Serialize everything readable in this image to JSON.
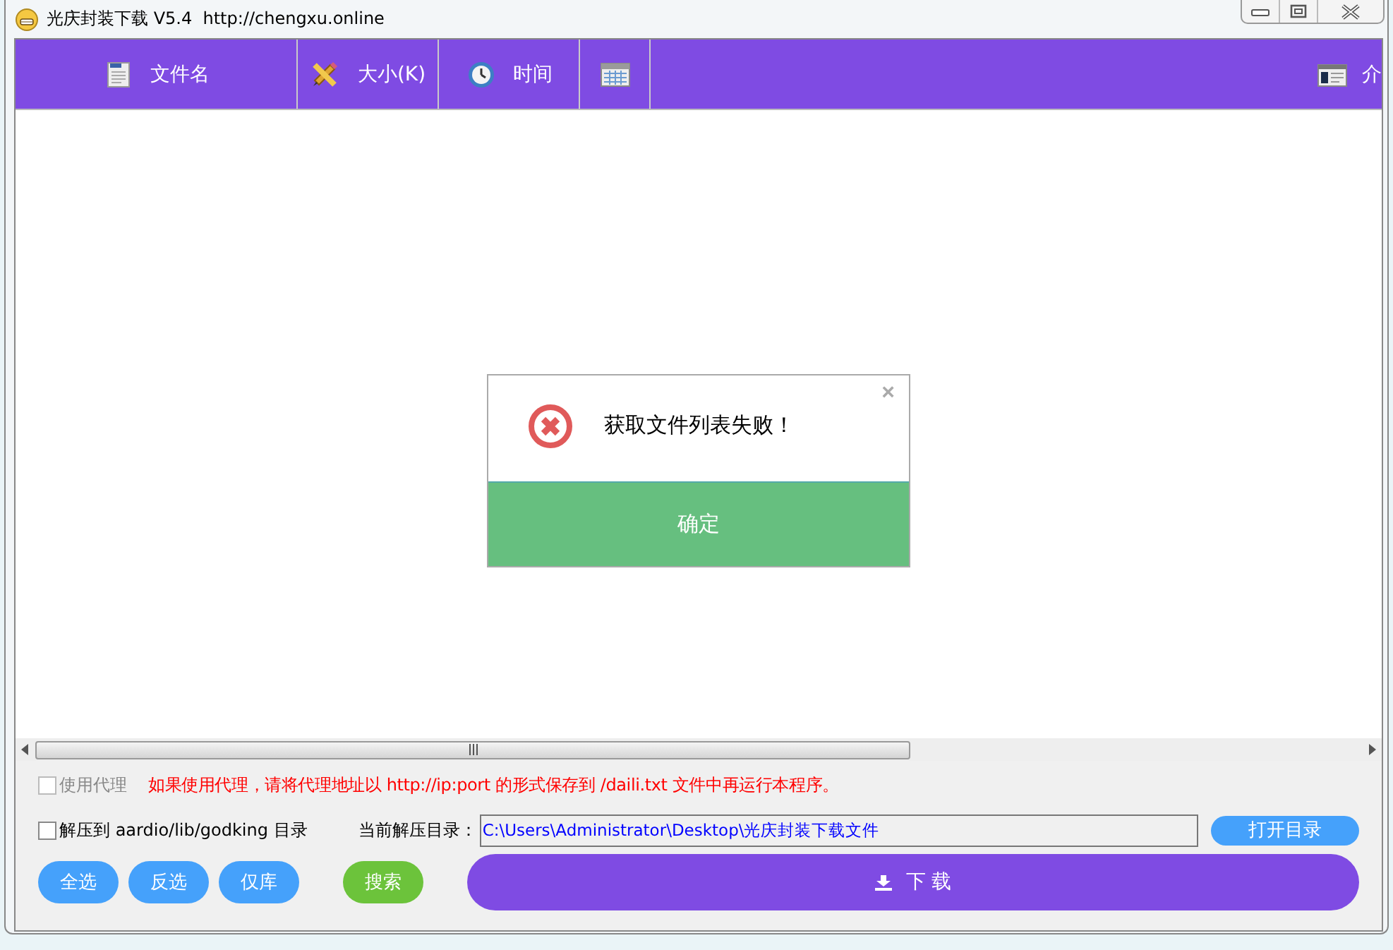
{
  "window": {
    "title": "光庆封装下载 V5.4  http://chengxu.online"
  },
  "columns": [
    {
      "label": "文件名"
    },
    {
      "label": "大小(K)"
    },
    {
      "label": "时间"
    },
    {},
    {
      "label": "介"
    }
  ],
  "dialog": {
    "message": "获取文件列表失败！",
    "close": "×",
    "confirm": "确定"
  },
  "proxy": {
    "label": "使用代理",
    "checked": false,
    "disabled": true,
    "note": "如果使用代理，请将代理地址以 http://ip:port 的形式保存到 /daili.txt 文件中再运行本程序。"
  },
  "extract": {
    "label": "解压到 aardio/lib/godking 目录",
    "checked": false
  },
  "path": {
    "label": "当前解压目录：",
    "value": "C:\\Users\\Administrator\\Desktop\\光庆封装下载文件",
    "button": "打开目录"
  },
  "buttons": [
    {
      "label": "全选",
      "kind": "blue"
    },
    {
      "label": "反选",
      "kind": "blue"
    },
    {
      "label": "仅库",
      "kind": "blue"
    },
    {
      "label": "搜索",
      "kind": "green"
    }
  ],
  "download": {
    "label": "下 载"
  }
}
